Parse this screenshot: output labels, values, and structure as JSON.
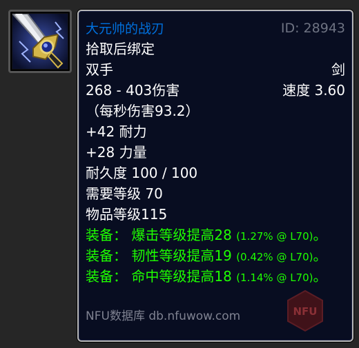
{
  "item": {
    "name": "大元帅的战刃",
    "id_label": "ID: 28943",
    "binding": "拾取后绑定",
    "slot": "双手",
    "type": "剑",
    "damage": "268 - 403伤害",
    "speed": "速度 3.60",
    "dps": "（每秒伤害93.2）",
    "stamina": "+42 耐力",
    "strength": "+28 力量",
    "durability": "耐久度 100 / 100",
    "required_level": "需要等级 70",
    "item_level": "物品等级115",
    "equip_effects": [
      {
        "label": "装备：",
        "text": "爆击等级提高28",
        "detail": "(1.27% @ L70)",
        "end": "。"
      },
      {
        "label": "装备：",
        "text": "韧性等级提高19",
        "detail": "(0.42% @ L70)",
        "end": "。"
      },
      {
        "label": "装备：",
        "text": "命中等级提高18",
        "detail": "(1.14% @ L70)",
        "end": "。"
      }
    ]
  },
  "footer": "NFU数据库 db.nfuwow.com",
  "watermark": "NFU",
  "icon": "sword-hilt-icon",
  "colors": {
    "name": "#0070dd",
    "equip": "#1eff00",
    "background": "#080d21",
    "id": "#6e7382"
  }
}
